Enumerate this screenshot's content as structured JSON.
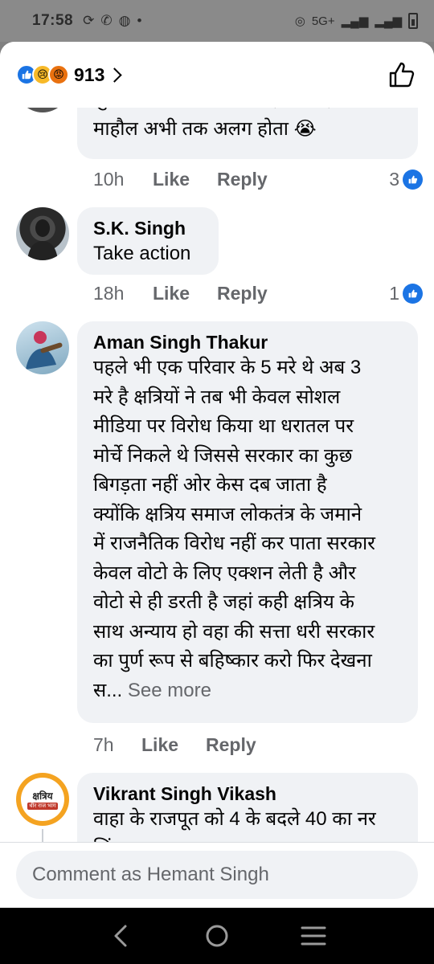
{
  "status_bar": {
    "time": "17:58",
    "network": "5G+"
  },
  "header": {
    "reaction_count": "913"
  },
  "comments": [
    {
      "text_partial_top": "सुधार गया था पाया उस नहा फिर हाता ता",
      "text_last": "माहौल अभी तक अलग होता 😭",
      "time": "10h",
      "like_label": "Like",
      "reply_label": "Reply",
      "likes": "3"
    },
    {
      "author": "S.K. Singh",
      "text": "Take action",
      "time": "18h",
      "like_label": "Like",
      "reply_label": "Reply",
      "likes": "1"
    },
    {
      "author": "Aman Singh Thakur",
      "lines": [
        "पहले भी एक परिवार के 5 मरे थे अब 3",
        "मरे है क्षत्रियों ने तब भी केवल सोशल",
        "मीडिया पर विरोध किया था धरातल पर",
        "मोर्चे निकले थे जिससे सरकार का कुछ",
        "बिगड़ता नहीं ओर केस दब जाता है",
        "क्योंकि क्षत्रिय समाज लोकतंत्र के जमाने",
        "में राजनैतिक विरोध नहीं कर पाता सरकार",
        "केवल वोटो के लिए एक्शन लेती है और",
        "वोटो से ही डरती है जहां कही क्षत्रिय के",
        "साथ अन्याय हो वहा की सत्ता धरी सरकार",
        "का पुर्ण रूप से बहिष्कार करो फिर देखना"
      ],
      "last_line": "स...",
      "see_more": "See more",
      "time": "7h",
      "like_label": "Like",
      "reply_label": "Reply"
    },
    {
      "author": "Vikrant Singh Vikash",
      "avatar_text": "क्षत्रिय",
      "avatar_subtext": "धीर राज भाग",
      "text": "वाहा के राजपूत को 4 के बदले 40 का नर",
      "text_partial_bottom": "लिं का क"
    }
  ],
  "composer": {
    "placeholder": "Comment as Hemant Singh"
  },
  "colors": {
    "accent": "#1b74e4",
    "bubble": "#f0f2f5",
    "muted": "#65676b"
  }
}
